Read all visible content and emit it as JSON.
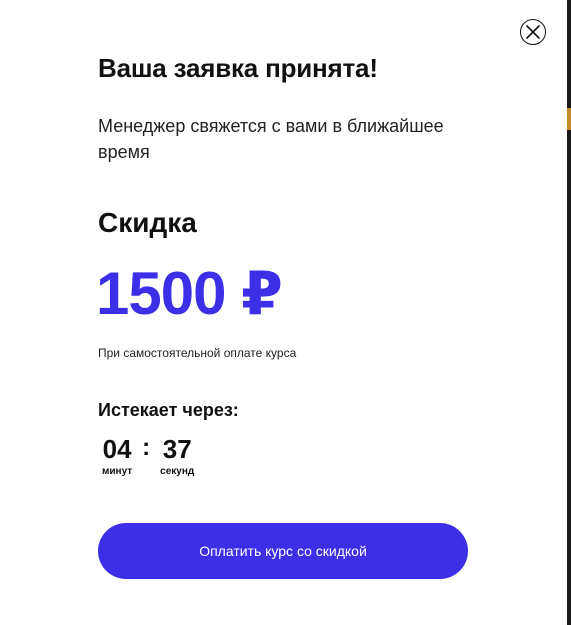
{
  "modal": {
    "title": "Ваша заявка принята!",
    "subtitle": "Менеджер свяжется с вами в ближайшее время",
    "discount_label": "Скидка",
    "discount_amount": "1500 ₽",
    "discount_note": "При самостоятельной оплате курса",
    "expires_label": "Истекает через:",
    "timer": {
      "minutes": "04",
      "minutes_caption": "минут",
      "separator": ":",
      "seconds": "37",
      "seconds_caption": "секунд"
    },
    "pay_button_label": "Оплатить курс со скидкой",
    "close_icon": "close-icon"
  },
  "colors": {
    "accent": "#3d2ee8",
    "text": "#111111",
    "background": "#ffffff"
  }
}
